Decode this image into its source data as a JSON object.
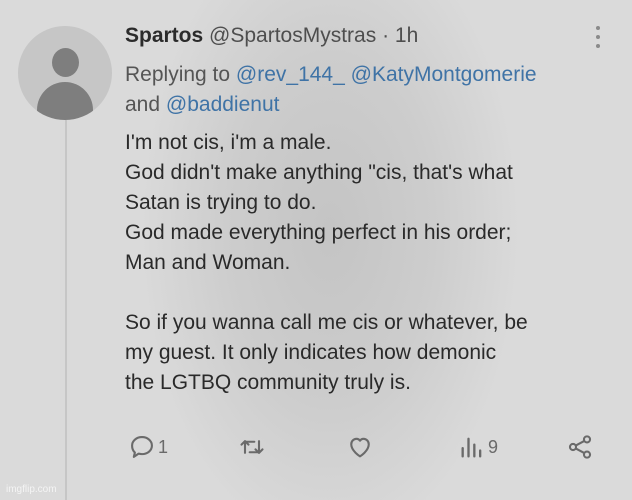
{
  "tweet": {
    "display_name": "Spartos",
    "handle": "@SpartosMystras",
    "separator": "·",
    "time": "1h"
  },
  "reply_to": {
    "prefix": "Replying to",
    "mentions": [
      "@rev_144_",
      "@KatyMontgomerie",
      "@baddienut"
    ],
    "joiner": "and"
  },
  "body": {
    "lines": [
      "I'm not cis, i'm a male.",
      "God didn't make anything \"cis, that's what",
      "Satan is trying to do.",
      "God made everything perfect in his order;",
      "Man and Woman.",
      "",
      "So if you wanna call me cis or whatever, be",
      "my guest. It only indicates how demonic",
      "the LGTBQ community truly is."
    ]
  },
  "actions": {
    "reply_count": "1",
    "retweet_count": "",
    "like_count": "",
    "views_count": "9"
  },
  "icons": [
    "more-icon",
    "reply-icon",
    "retweet-icon",
    "like-icon",
    "views-icon",
    "share-icon"
  ],
  "watermark": "imgflip.com"
}
